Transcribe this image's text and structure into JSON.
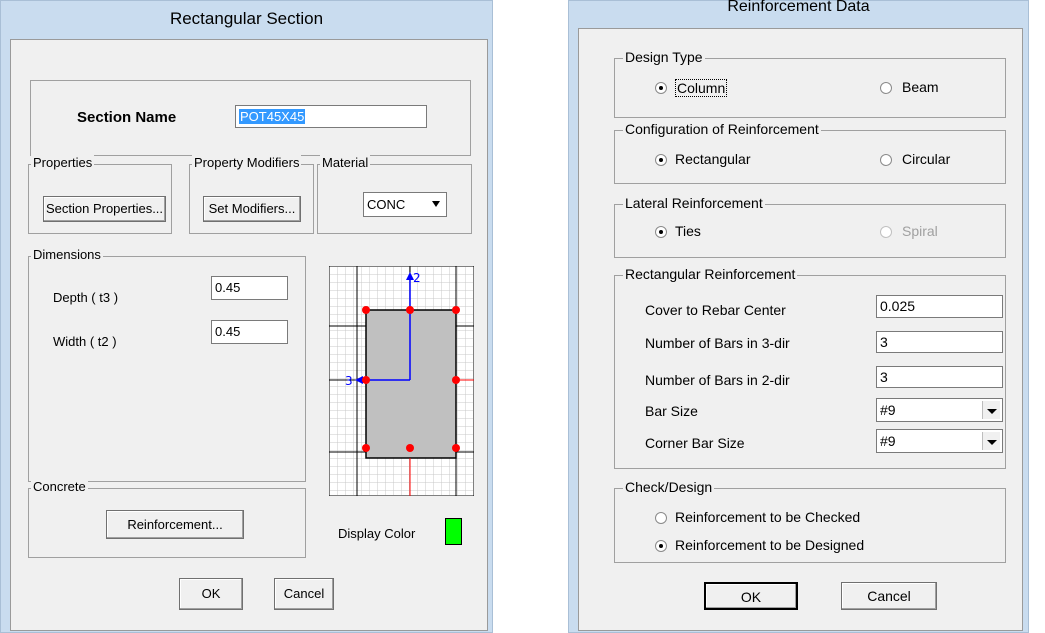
{
  "left": {
    "title": "Rectangular Section",
    "section_name_label": "Section Name",
    "section_name_value": "POT45X45",
    "properties_group": "Properties",
    "section_properties_button": "Section Properties...",
    "modifiers_group": "Property Modifiers",
    "set_modifiers_button": "Set Modifiers...",
    "material_group": "Material",
    "material_value": "CONC",
    "dimensions_group": "Dimensions",
    "depth_label": "Depth ( t3 )",
    "depth_value": "0.45",
    "width_label": "Width ( t2 )",
    "width_value": "0.45",
    "axis_2": "2",
    "axis_3": "3",
    "concrete_group": "Concrete",
    "reinforcement_button": "Reinforcement...",
    "display_color_label": "Display Color",
    "display_color": "#00ff00",
    "ok_button": "OK",
    "cancel_button": "Cancel"
  },
  "right": {
    "title": "Reinforcement Data",
    "design_type_group": "Design Type",
    "column_option": "Column",
    "beam_option": "Beam",
    "config_group": "Configuration of Reinforcement",
    "rectangular_option": "Rectangular",
    "circular_option": "Circular",
    "lateral_group": "Lateral Reinforcement",
    "ties_option": "Ties",
    "spiral_option": "Spiral",
    "rect_reinf_group": "Rectangular Reinforcement",
    "cover_label": "Cover to Rebar Center",
    "cover_value": "0.025",
    "bars3_label": "Number of Bars in 3-dir",
    "bars3_value": "3",
    "bars2_label": "Number of Bars in 2-dir",
    "bars2_value": "3",
    "bar_size_label": "Bar Size",
    "bar_size_value": "#9",
    "corner_bar_label": "Corner Bar Size",
    "corner_bar_value": "#9",
    "check_group": "Check/Design",
    "checked_option": "Reinforcement to be Checked",
    "designed_option": "Reinforcement to be Designed",
    "ok_button": "OK",
    "cancel_button": "Cancel"
  }
}
